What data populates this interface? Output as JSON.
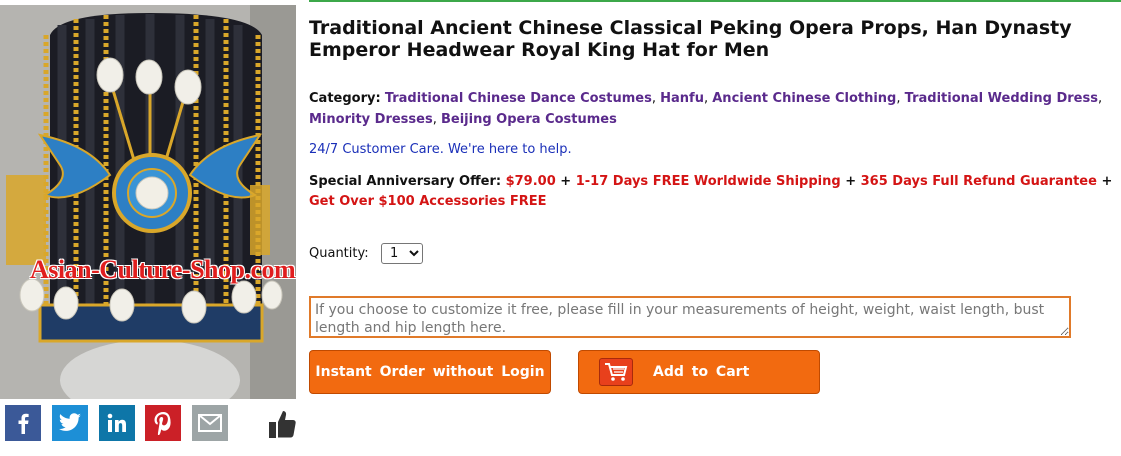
{
  "product": {
    "title": "Traditional Ancient Chinese Classical Peking Opera Props, Han Dynasty Emperor Headwear Royal King Hat for Men",
    "watermark": "Asian-Culture-Shop.com"
  },
  "category": {
    "label": "Category:",
    "links": [
      "Traditional Chinese Dance Costumes",
      "Hanfu",
      "Ancient Chinese Clothing",
      "Traditional Wedding Dress",
      "Minority Dresses",
      "Beijing Opera Costumes"
    ],
    "separator": ","
  },
  "care": "24/7 Customer Care. We're here to help.",
  "offer": {
    "label": "Special Anniversary Offer:",
    "price": "$79.00",
    "plus": "+",
    "shipping": "1-17 Days FREE Worldwide Shipping",
    "refund": "365 Days Full Refund Guarantee",
    "accessories": "Get Over $100 Accessories FREE"
  },
  "quantity": {
    "label": "Quantity:",
    "selected": "1"
  },
  "customize": {
    "placeholder": "If you choose to customize it free, please fill in your measurements of height, weight, waist length, bust length and hip length here."
  },
  "buttons": {
    "instant_order": "Instant Order without Login",
    "add_to_cart": "Add to Cart"
  },
  "share": {
    "icons": [
      "facebook-icon",
      "twitter-icon",
      "linkedin-icon",
      "pinterest-icon",
      "email-icon",
      "thumbs-up-icon"
    ]
  },
  "colors": {
    "accent_orange": "#f26a10",
    "link_purple": "#5a2a8c",
    "offer_red": "#d41414",
    "care_blue": "#1a2fb8",
    "top_line_green": "#3ca84a"
  }
}
